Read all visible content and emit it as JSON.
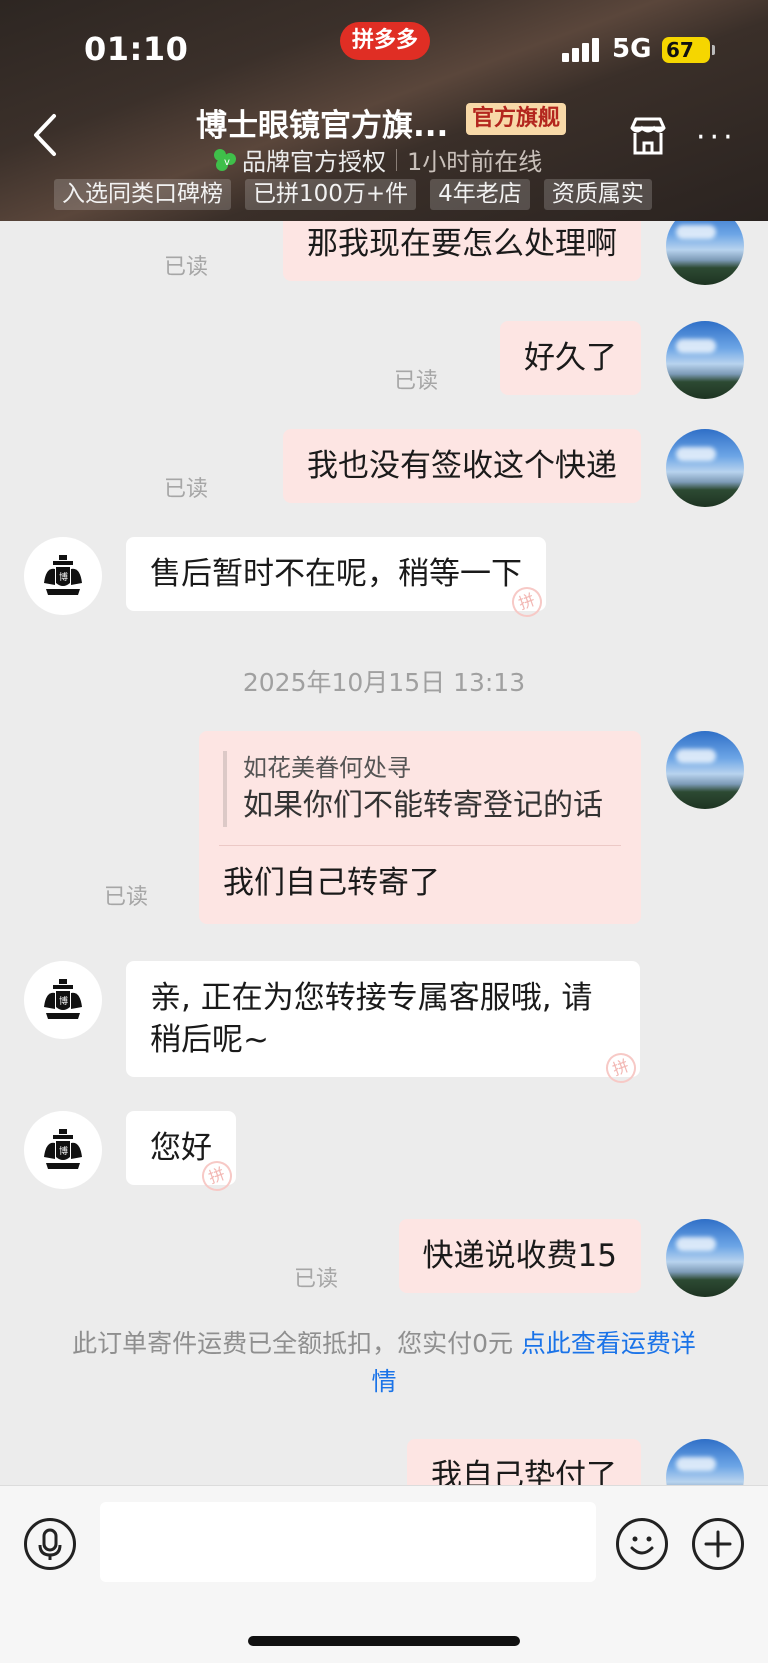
{
  "status_bar": {
    "time": "01:10",
    "app_logo": "拼多多",
    "network": "5G",
    "battery": "67"
  },
  "header": {
    "shop_name": "博士眼镜官方旗...",
    "official_tag": "官方旗舰",
    "brand_auth": "品牌官方授权",
    "online_status": "1小时前在线",
    "tags": [
      "入选同类口碑榜",
      "已拼100万+件",
      "4年老店",
      "资质属实"
    ]
  },
  "chat": {
    "read_label": "已读",
    "messages": [
      {
        "text": "那我现在要怎么处理啊"
      },
      {
        "text": "好久了"
      },
      {
        "text": "我也没有签收这个快递"
      },
      {
        "text": "售后暂时不在呢，稍等一下"
      },
      {
        "quote_author": "如花美眷何处寻",
        "quote_text": "如果你们不能转寄登记的话",
        "text": "我们自己转寄了"
      },
      {
        "text_line1": "亲, 正在为您转接专属客服哦, 请",
        "text_line2": "稍后呢~"
      },
      {
        "text": "您好"
      },
      {
        "text": "快递说收费15"
      },
      {
        "text": "我自己垫付了"
      }
    ],
    "timestamp": "2025年10月15日 13:13",
    "notice": {
      "text": "此订单寄件运费已全额抵扣，您实付0元 ",
      "link": "点此查看运费详情"
    }
  },
  "input_bar": {
    "placeholder": ""
  },
  "colors": {
    "outgoing_bubble": "#fde5e3",
    "incoming_bubble": "#ffffff",
    "link": "#1a73e8",
    "pdd_red": "#e02e24"
  }
}
